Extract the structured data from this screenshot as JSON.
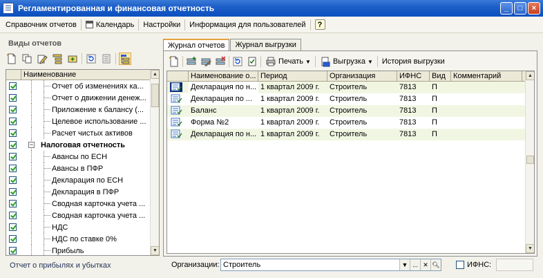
{
  "window": {
    "title": "Регламентированная и финансовая отчетность"
  },
  "menubar": {
    "items": [
      {
        "label": "Справочник отчетов"
      },
      {
        "label": "Календарь"
      },
      {
        "label": "Настройки"
      },
      {
        "label": "Информация для пользователей"
      }
    ],
    "help_label": "?"
  },
  "left_panel": {
    "title": "Виды отчетов",
    "column_header": "Наименование",
    "tree": [
      {
        "label": "Отчет об изменениях ка...",
        "level": 2,
        "checked": true
      },
      {
        "label": "Отчет о движении денеж...",
        "level": 2,
        "checked": true
      },
      {
        "label": "Приложение к балансу (...",
        "level": 2,
        "checked": true
      },
      {
        "label": "Целевое использование ...",
        "level": 2,
        "checked": true
      },
      {
        "label": "Расчет чистых активов",
        "level": 2,
        "checked": true
      },
      {
        "label": "Налоговая отчетность",
        "level": 1,
        "checked": true,
        "group": true,
        "expander": "−"
      },
      {
        "label": "Авансы по ЕСН",
        "level": 2,
        "checked": true
      },
      {
        "label": "Авансы в ПФР",
        "level": 2,
        "checked": true
      },
      {
        "label": "Декларация по ЕСН",
        "level": 2,
        "checked": true
      },
      {
        "label": "Декларация в ПФР",
        "level": 2,
        "checked": true
      },
      {
        "label": "Сводная карточка учета ...",
        "level": 2,
        "checked": true
      },
      {
        "label": "Сводная карточка учета ...",
        "level": 2,
        "checked": true
      },
      {
        "label": "НДС",
        "level": 2,
        "checked": true
      },
      {
        "label": "НДС по ставке 0%",
        "level": 2,
        "checked": true
      },
      {
        "label": "Прибыль",
        "level": 2,
        "checked": true
      }
    ],
    "status_text": "Отчет о прибылях и убытках"
  },
  "tabs": [
    {
      "label": "Журнал отчетов",
      "active": true
    },
    {
      "label": "Журнал выгрузки",
      "active": false
    }
  ],
  "right_toolbar": {
    "print_label": "Печать",
    "export_label": "Выгрузка",
    "history_label": "История выгрузки"
  },
  "grid": {
    "columns": [
      "Наименование о...",
      "Период",
      "Организация",
      "ИФНС",
      "Вид",
      "Комментарий"
    ],
    "rows": [
      {
        "name": "Декларация по н...",
        "period": "1 квартал 2009 г.",
        "org": "Строитель",
        "ifns": "7813",
        "type": "П",
        "comment": ""
      },
      {
        "name": "Декларация по ...",
        "period": "1 квартал 2009 г.",
        "org": "Строитель",
        "ifns": "7813",
        "type": "П",
        "comment": ""
      },
      {
        "name": "Баланс",
        "period": "1 квартал 2009 г.",
        "org": "Строитель",
        "ifns": "7813",
        "type": "П",
        "comment": ""
      },
      {
        "name": "Форма №2",
        "period": "1 квартал 2009 г.",
        "org": "Строитель",
        "ifns": "7813",
        "type": "П",
        "comment": ""
      },
      {
        "name": "Декларация по н...",
        "period": "1 квартал 2009 г.",
        "org": "Строитель",
        "ifns": "7813",
        "type": "П",
        "comment": ""
      }
    ]
  },
  "filter": {
    "org_label": "Организации:",
    "org_value": "Строитель",
    "ellipsis_label": "...",
    "ifns_label": "ИФНС:",
    "ifns_checked": false
  }
}
